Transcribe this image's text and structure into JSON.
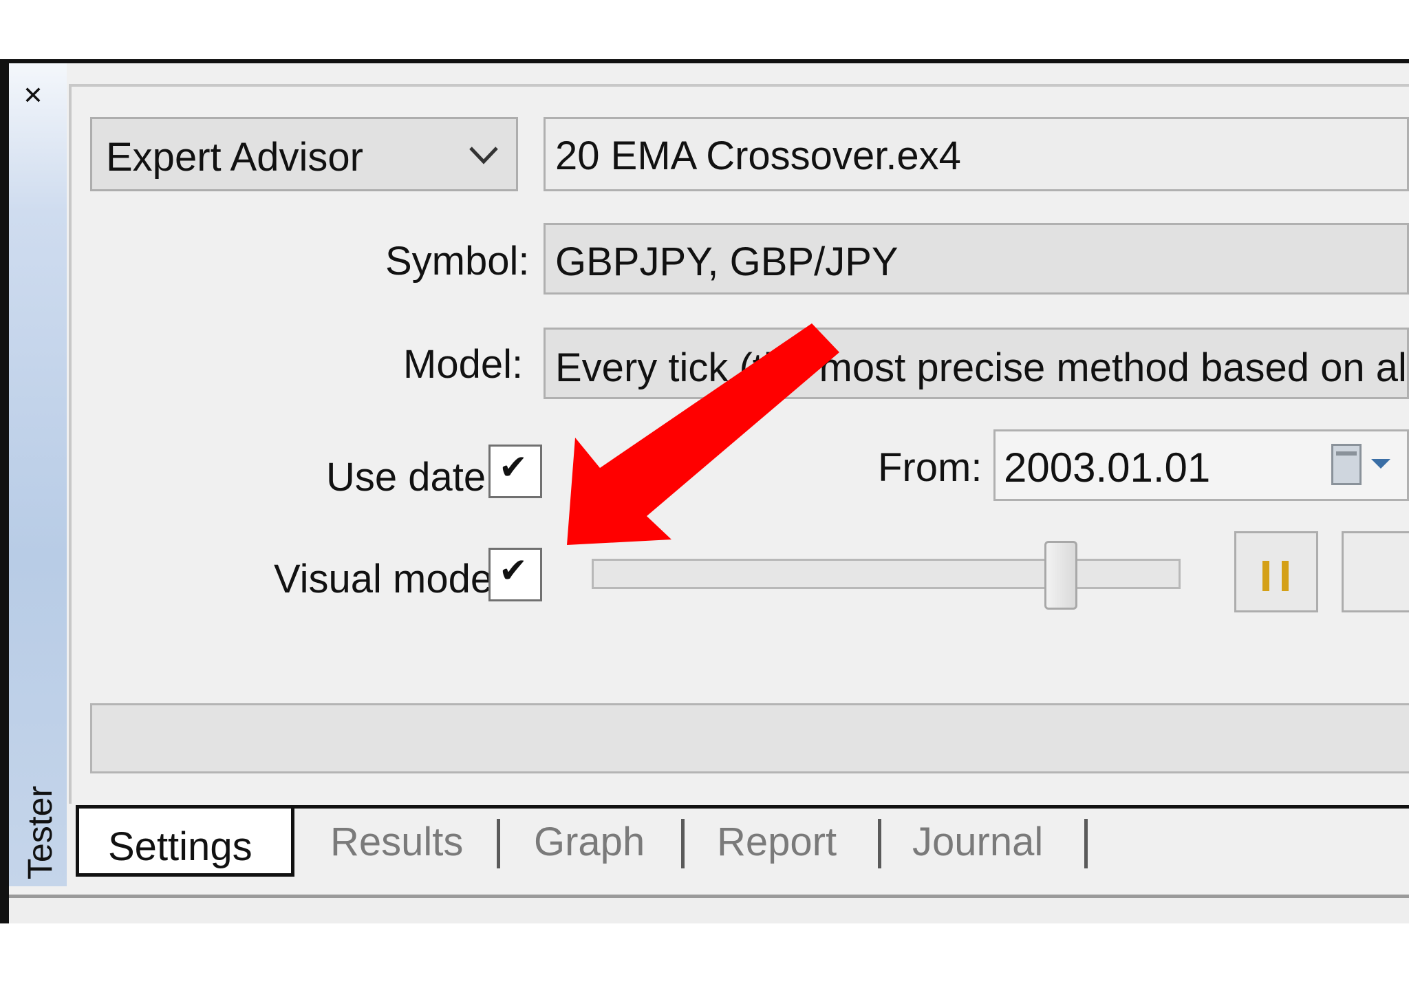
{
  "window": {
    "close_icon": "close-icon",
    "side_label": "Tester"
  },
  "settings": {
    "type_select": {
      "value": "Expert Advisor",
      "icon": "chevron-down-icon"
    },
    "expert_file": "20 EMA Crossover.ex4",
    "symbol": {
      "label": "Symbol:",
      "value": "GBPJPY, GBP/JPY"
    },
    "model": {
      "label": "Model:",
      "value": "Every tick (the most precise method based on all av"
    },
    "use_date": {
      "label": "Use date",
      "checked": true,
      "check_glyph": "✔"
    },
    "from": {
      "label": "From:",
      "value": "2003.01.01",
      "icon": "calendar-icon"
    },
    "visual_mode": {
      "label": "Visual mode",
      "checked": true,
      "check_glyph": "✔",
      "speed_level": 0.8
    },
    "pause_button": {
      "icon": "pause-icon"
    },
    "progress": 0
  },
  "tabs": [
    {
      "label": "Settings",
      "active": true
    },
    {
      "label": "Results",
      "active": false
    },
    {
      "label": "Graph",
      "active": false
    },
    {
      "label": "Report",
      "active": false
    },
    {
      "label": "Journal",
      "active": false
    }
  ],
  "annotation": {
    "icon": "red-arrow-icon",
    "color": "#ff0000"
  },
  "colors": {
    "tester_strip": "#b8cce6",
    "pause_icon": "#d4a017"
  }
}
